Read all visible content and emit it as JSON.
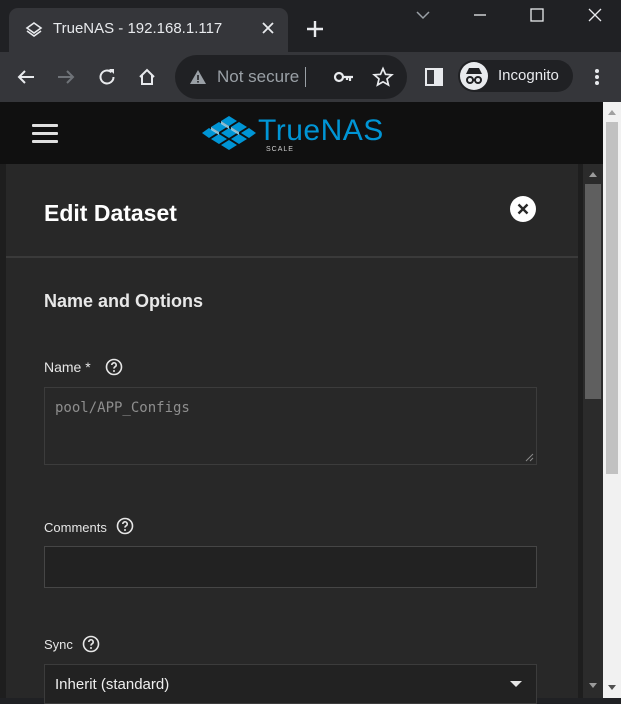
{
  "browser": {
    "tab_title": "TrueNAS - 192.168.1.117",
    "address_security": "Not secure",
    "incognito_label": "Incognito",
    "icons": [
      "truenas-favicon",
      "close-icon",
      "plus-icon",
      "minimize-icon",
      "maximize-icon",
      "close-window-icon",
      "back-icon",
      "forward-icon",
      "reload-icon",
      "home-icon",
      "warning-icon",
      "key-icon",
      "star-icon",
      "side-panel-icon",
      "incognito-icon",
      "more-vert-icon"
    ]
  },
  "app": {
    "brand": "TrueNAS",
    "brand_sub": "SCALE"
  },
  "dialog": {
    "title": "Edit Dataset",
    "section_title": "Name and Options",
    "fields": {
      "name": {
        "label": "Name *",
        "value": "pool/APP_Configs"
      },
      "comments": {
        "label": "Comments",
        "value": ""
      },
      "sync": {
        "label": "Sync",
        "value": "Inherit (standard)"
      }
    }
  },
  "colors": {
    "accent": "#0095d5",
    "panel_bg": "#282828",
    "header_bg": "#101010"
  }
}
